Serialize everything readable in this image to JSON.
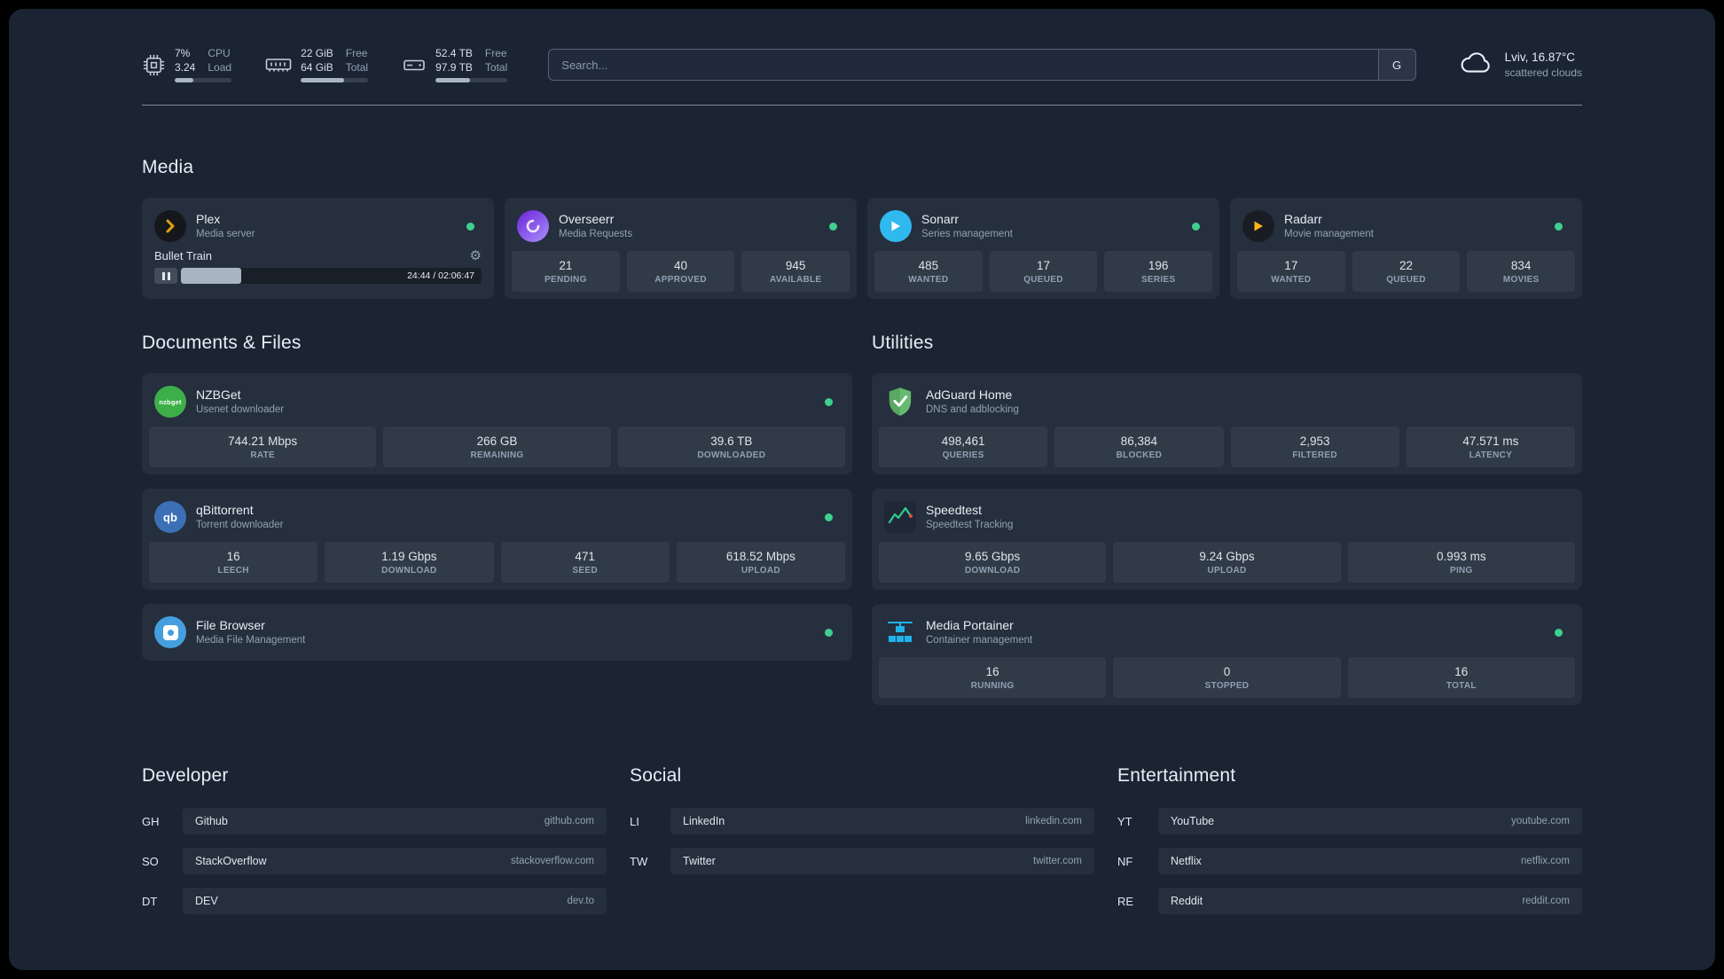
{
  "colors": {
    "status_online": "#3fcf8e",
    "plex_accent": "#e5a00d",
    "background": "#1a2433"
  },
  "topbar": {
    "resources": [
      {
        "icon": "cpu",
        "top_value": "7%",
        "bottom_value": "3.24",
        "top_label": "CPU",
        "bottom_label": "Load",
        "bar_percent": 33
      },
      {
        "icon": "ram",
        "top_value": "22 GiB",
        "bottom_value": "64 GiB",
        "top_label": "Free",
        "bottom_label": "Total",
        "bar_percent": 65
      },
      {
        "icon": "disk",
        "top_value": "52.4 TB",
        "bottom_value": "97.9 TB",
        "top_label": "Free",
        "bottom_label": "Total",
        "bar_percent": 48
      }
    ],
    "search": {
      "placeholder": "Search...",
      "provider_label": "G"
    },
    "weather": {
      "location": "Lviv, 16.87°C",
      "condition": "scattered clouds"
    }
  },
  "media": {
    "title": "Media",
    "plex": {
      "name": "Plex",
      "subtitle": "Media server",
      "now_playing": "Bullet Train",
      "elapsed_total": "24:44 / 02:06:47",
      "progress_percent": 20
    },
    "overseerr": {
      "name": "Overseerr",
      "subtitle": "Media Requests",
      "stats": [
        {
          "value": "21",
          "label": "PENDING"
        },
        {
          "value": "40",
          "label": "APPROVED"
        },
        {
          "value": "945",
          "label": "AVAILABLE"
        }
      ]
    },
    "sonarr": {
      "name": "Sonarr",
      "subtitle": "Series management",
      "stats": [
        {
          "value": "485",
          "label": "WANTED"
        },
        {
          "value": "17",
          "label": "QUEUED"
        },
        {
          "value": "196",
          "label": "SERIES"
        }
      ]
    },
    "radarr": {
      "name": "Radarr",
      "subtitle": "Movie management",
      "stats": [
        {
          "value": "17",
          "label": "WANTED"
        },
        {
          "value": "22",
          "label": "QUEUED"
        },
        {
          "value": "834",
          "label": "MOVIES"
        }
      ]
    }
  },
  "documents": {
    "title": "Documents & Files",
    "nzbget": {
      "name": "NZBGet",
      "subtitle": "Usenet downloader",
      "icon_text": "nzbget",
      "stats": [
        {
          "value": "744.21 Mbps",
          "label": "RATE"
        },
        {
          "value": "266 GB",
          "label": "REMAINING"
        },
        {
          "value": "39.6 TB",
          "label": "DOWNLOADED"
        }
      ]
    },
    "qbittorrent": {
      "name": "qBittorrent",
      "subtitle": "Torrent downloader",
      "icon_text": "qb",
      "stats": [
        {
          "value": "16",
          "label": "LEECH"
        },
        {
          "value": "1.19 Gbps",
          "label": "DOWNLOAD"
        },
        {
          "value": "471",
          "label": "SEED"
        },
        {
          "value": "618.52 Mbps",
          "label": "UPLOAD"
        }
      ]
    },
    "filebrowser": {
      "name": "File Browser",
      "subtitle": "Media File Management"
    }
  },
  "utilities": {
    "title": "Utilities",
    "adguard": {
      "name": "AdGuard Home",
      "subtitle": "DNS and adblocking",
      "stats": [
        {
          "value": "498,461",
          "label": "QUERIES"
        },
        {
          "value": "86,384",
          "label": "BLOCKED"
        },
        {
          "value": "2,953",
          "label": "FILTERED"
        },
        {
          "value": "47.571 ms",
          "label": "LATENCY"
        }
      ]
    },
    "speedtest": {
      "name": "Speedtest",
      "subtitle": "Speedtest Tracking",
      "stats": [
        {
          "value": "9.65 Gbps",
          "label": "DOWNLOAD"
        },
        {
          "value": "9.24 Gbps",
          "label": "UPLOAD"
        },
        {
          "value": "0.993 ms",
          "label": "PING"
        }
      ]
    },
    "portainer": {
      "name": "Media Portainer",
      "subtitle": "Container management",
      "stats": [
        {
          "value": "16",
          "label": "RUNNING"
        },
        {
          "value": "0",
          "label": "STOPPED"
        },
        {
          "value": "16",
          "label": "TOTAL"
        }
      ]
    }
  },
  "bookmarks": [
    {
      "title": "Developer",
      "items": [
        {
          "abbr": "GH",
          "name": "Github",
          "url": "github.com"
        },
        {
          "abbr": "SO",
          "name": "StackOverflow",
          "url": "stackoverflow.com"
        },
        {
          "abbr": "DT",
          "name": "DEV",
          "url": "dev.to"
        }
      ]
    },
    {
      "title": "Social",
      "items": [
        {
          "abbr": "LI",
          "name": "LinkedIn",
          "url": "linkedin.com"
        },
        {
          "abbr": "TW",
          "name": "Twitter",
          "url": "twitter.com"
        }
      ]
    },
    {
      "title": "Entertainment",
      "items": [
        {
          "abbr": "YT",
          "name": "YouTube",
          "url": "youtube.com"
        },
        {
          "abbr": "NF",
          "name": "Netflix",
          "url": "netflix.com"
        },
        {
          "abbr": "RE",
          "name": "Reddit",
          "url": "reddit.com"
        }
      ]
    }
  ]
}
